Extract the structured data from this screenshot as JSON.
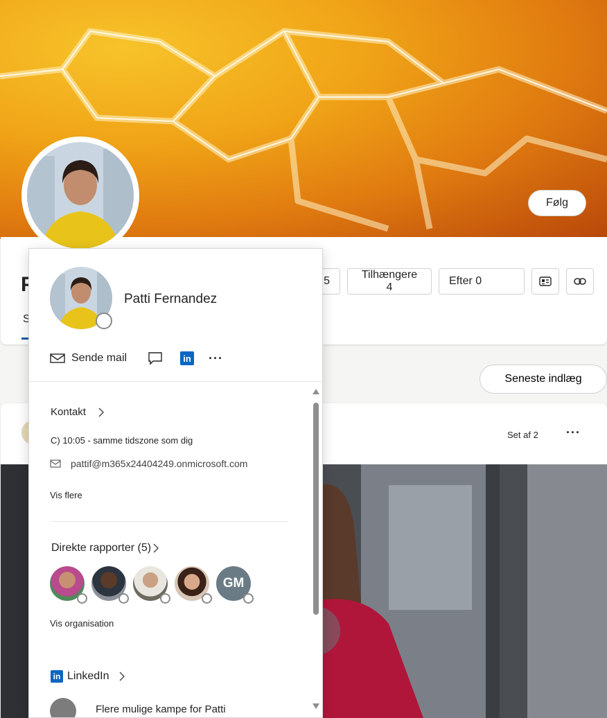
{
  "header": {
    "follow_label": "Følg",
    "name_initial": "P",
    "tab_first_letter": "S"
  },
  "stats": {
    "partial_count": "5",
    "followers_label": "Tilhængere 4",
    "following_label": "Efter 0"
  },
  "feed": {
    "recent_label": "Seneste indlæg",
    "seen_label": "Set af 2",
    "more_label": "···"
  },
  "popup": {
    "name": "Patti  Fernandez",
    "actions": {
      "email_label": "Sende mail",
      "more_label": "···"
    },
    "contact": {
      "title": "Kontakt",
      "time_text": "C) 10:05 - samme tidszone som dig",
      "email": "pattif@m365x24404249.onmicrosoft.com",
      "show_more": "Vis flere"
    },
    "reports": {
      "title": "Direkte rapporter (5)",
      "gm_initials": "GM",
      "show_org": "Vis organisation"
    },
    "linkedin": {
      "title": "LinkedIn",
      "more_matches": "Flere mulige kampe for Patti"
    }
  },
  "colors": {
    "accent": "#115ea3",
    "linkedin": "#0a66c2",
    "cover_mid": "#f0a417",
    "cover_dark": "#b8470a"
  }
}
